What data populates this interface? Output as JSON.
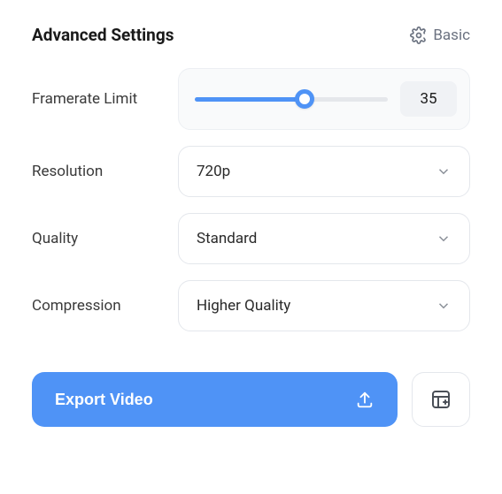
{
  "header": {
    "title": "Advanced Settings",
    "mode_toggle_label": "Basic"
  },
  "settings": {
    "framerate": {
      "label": "Framerate Limit",
      "value": "35",
      "percent": 57
    },
    "resolution": {
      "label": "Resolution",
      "value": "720p"
    },
    "quality": {
      "label": "Quality",
      "value": "Standard"
    },
    "compression": {
      "label": "Compression",
      "value": "Higher Quality"
    }
  },
  "footer": {
    "export_label": "Export Video"
  },
  "colors": {
    "accent": "#4f93f6",
    "border": "#e4e7ec",
    "muted": "#6b7280"
  }
}
